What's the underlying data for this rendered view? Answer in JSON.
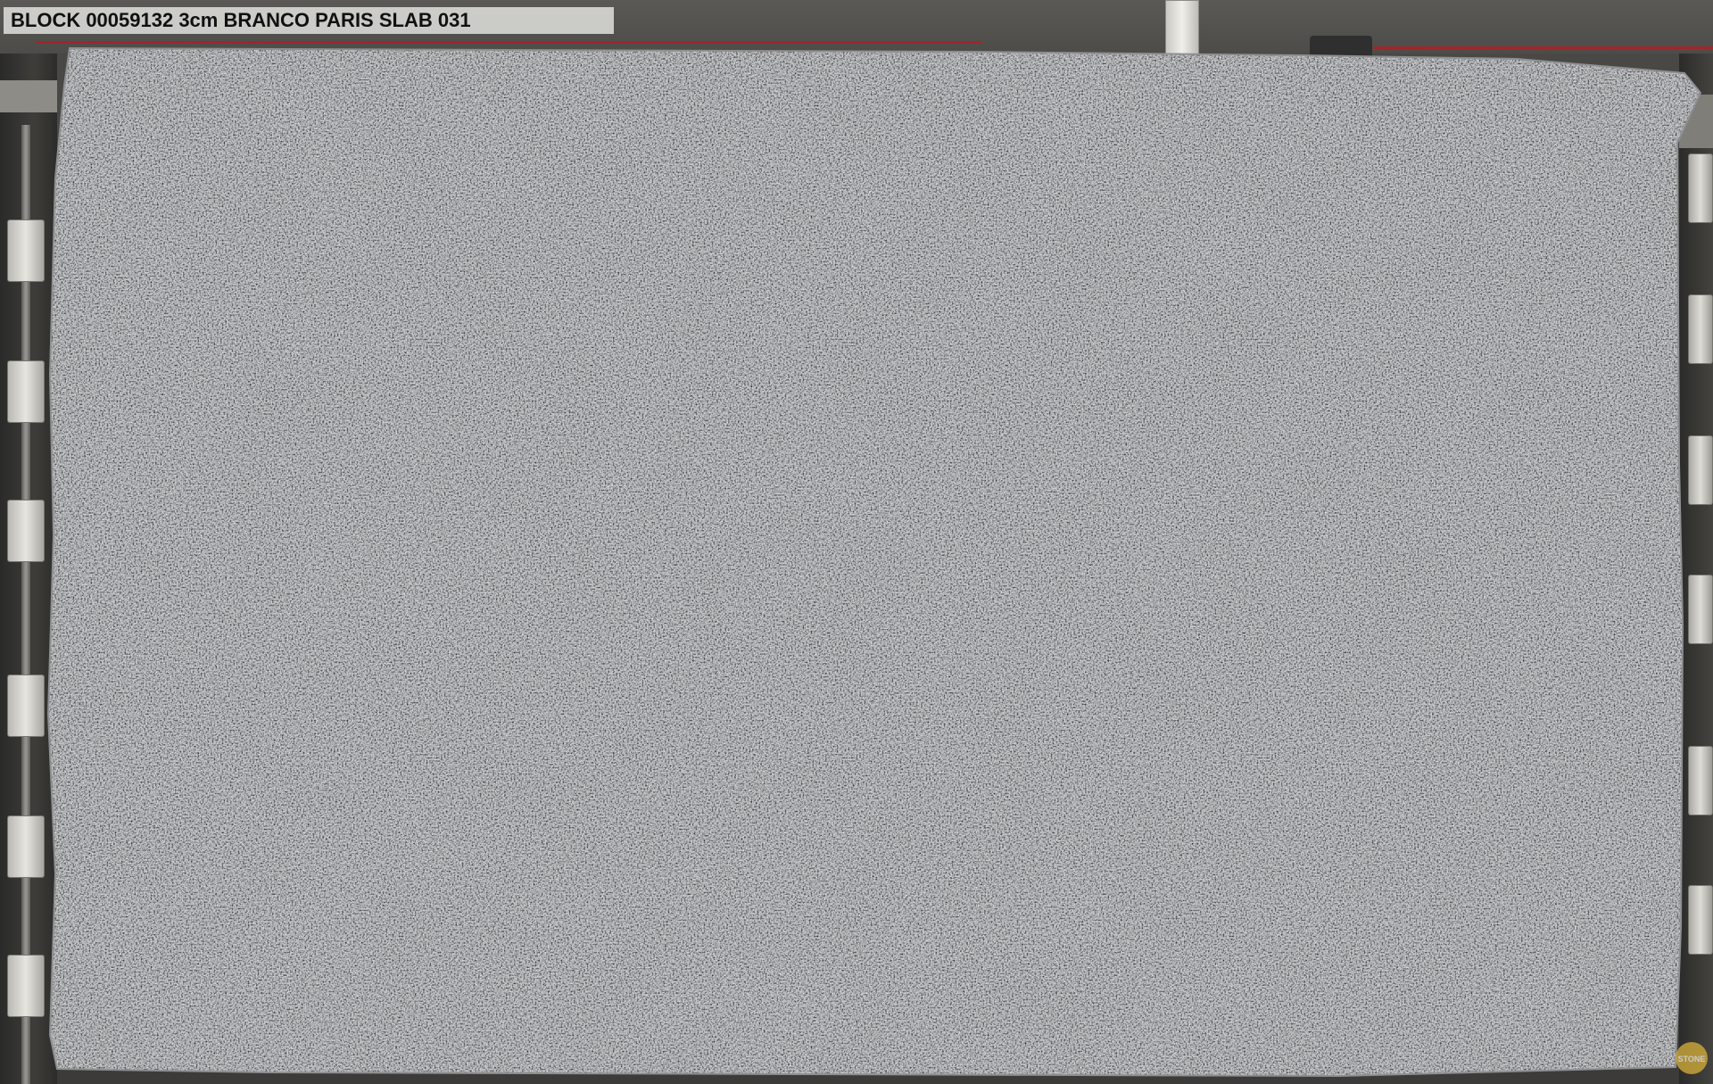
{
  "image": {
    "caption": "BLOCK 00059132 3cm BRANCO PARIS SLAB 031",
    "watermark_text": "STONE"
  },
  "colors": {
    "slab_base": "#b4b5b7",
    "slab_light": "#e4e5e6",
    "slab_dark": "#3b3d42",
    "background": "#3c3b39",
    "cable": "#a0262a",
    "label_bg": "#d6d6d2"
  },
  "icons": {
    "watermark": "stone-logo-icon"
  }
}
